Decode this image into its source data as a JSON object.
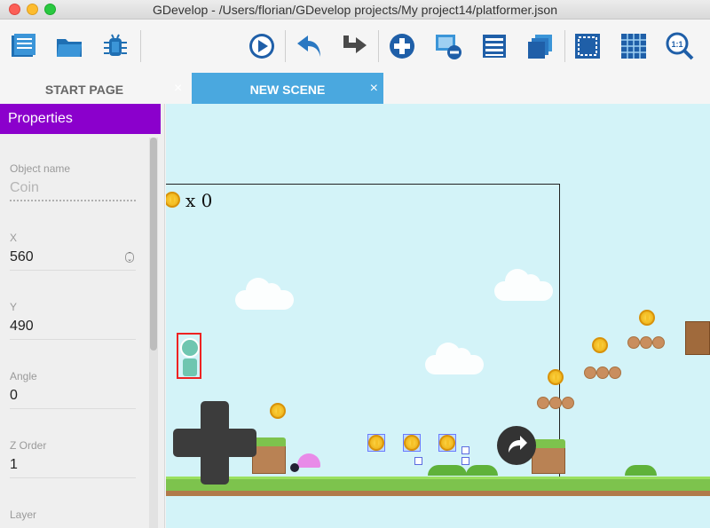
{
  "window": {
    "title": "GDevelop - /Users/florian/GDevelop projects/My project14/platformer.json"
  },
  "toolbar": {
    "buttons": [
      {
        "name": "project-manager",
        "icon": "project-manager-icon"
      },
      {
        "name": "open-project",
        "icon": "folder-icon"
      },
      {
        "name": "debugger",
        "icon": "bug-icon"
      },
      {
        "name": "preview",
        "icon": "play-icon"
      },
      {
        "name": "undo",
        "icon": "undo-icon"
      },
      {
        "name": "redo",
        "icon": "redo-icon"
      },
      {
        "name": "add-instance",
        "icon": "plus-icon"
      },
      {
        "name": "remove-instance",
        "icon": "remove-icon"
      },
      {
        "name": "instances-list",
        "icon": "list-icon"
      },
      {
        "name": "layers",
        "icon": "layers-icon"
      },
      {
        "name": "window-mask",
        "icon": "mask-icon"
      },
      {
        "name": "grid",
        "icon": "grid-icon"
      },
      {
        "name": "zoom-reset",
        "icon": "zoom-icon"
      }
    ],
    "zoom_label": "1:1"
  },
  "tabs": [
    {
      "label": "START PAGE",
      "close": "×"
    },
    {
      "label": "NEW SCENE",
      "close": "×"
    }
  ],
  "properties": {
    "header": "Properties",
    "fields": [
      {
        "label": "Object name",
        "value": "Coin"
      },
      {
        "label": "X",
        "value": "560"
      },
      {
        "label": "Y",
        "value": "490"
      },
      {
        "label": "Angle",
        "value": "0"
      },
      {
        "label": "Z Order",
        "value": "1"
      },
      {
        "label": "Layer",
        "value": ""
      }
    ]
  },
  "scene": {
    "score_text": "x 0",
    "colors": {
      "sky": "#d3f3f8",
      "grass": "#7dc34d",
      "accent": "#4aa8df",
      "panel_header": "#8b00cc"
    }
  }
}
